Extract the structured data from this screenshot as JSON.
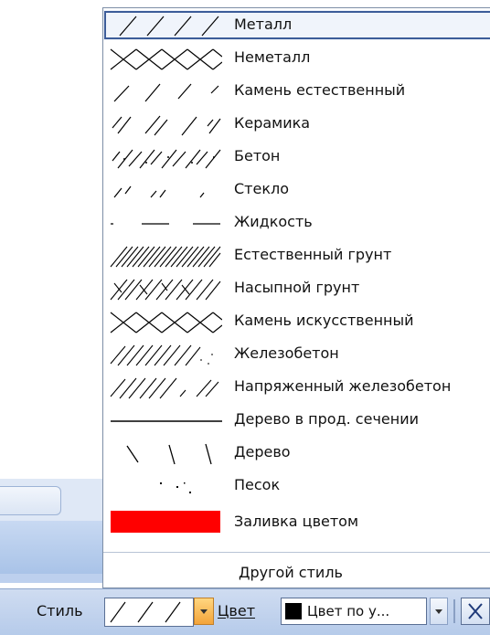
{
  "menu": {
    "items": [
      {
        "label": "Металл",
        "pattern": "metal-hatch-icon"
      },
      {
        "label": "Неметалл",
        "pattern": "nonmetal-hatch-icon"
      },
      {
        "label": "Камень естественный",
        "pattern": "natural-stone-hatch-icon"
      },
      {
        "label": "Керамика",
        "pattern": "ceramic-hatch-icon"
      },
      {
        "label": "Бетон",
        "pattern": "concrete-hatch-icon"
      },
      {
        "label": "Стекло",
        "pattern": "glass-hatch-icon"
      },
      {
        "label": "Жидкость",
        "pattern": "liquid-hatch-icon"
      },
      {
        "label": "Естественный грунт",
        "pattern": "natural-soil-hatch-icon"
      },
      {
        "label": "Насыпной грунт",
        "pattern": "bulk-soil-hatch-icon"
      },
      {
        "label": "Камень искусственный",
        "pattern": "artificial-stone-hatch-icon"
      },
      {
        "label": "Железобетон",
        "pattern": "reinforced-concrete-hatch-icon"
      },
      {
        "label": "Напряженный железобетон",
        "pattern": "prestressed-concrete-hatch-icon"
      },
      {
        "label": "Дерево в прод. сечении",
        "pattern": "wood-longitudinal-hatch-icon"
      },
      {
        "label": "Дерево",
        "pattern": "wood-hatch-icon"
      },
      {
        "label": "Песок",
        "pattern": "sand-hatch-icon"
      },
      {
        "label": "Заливка цветом",
        "pattern": "color-fill-icon"
      }
    ],
    "other_style": "Другой стиль",
    "fill_color": "#ff0000"
  },
  "toolbar": {
    "style_label": "Стиль",
    "style_current": "metal-hatch-icon",
    "color_label": "Цвет",
    "color_value": "Цвет по у...",
    "color_swatch": "#000000"
  }
}
